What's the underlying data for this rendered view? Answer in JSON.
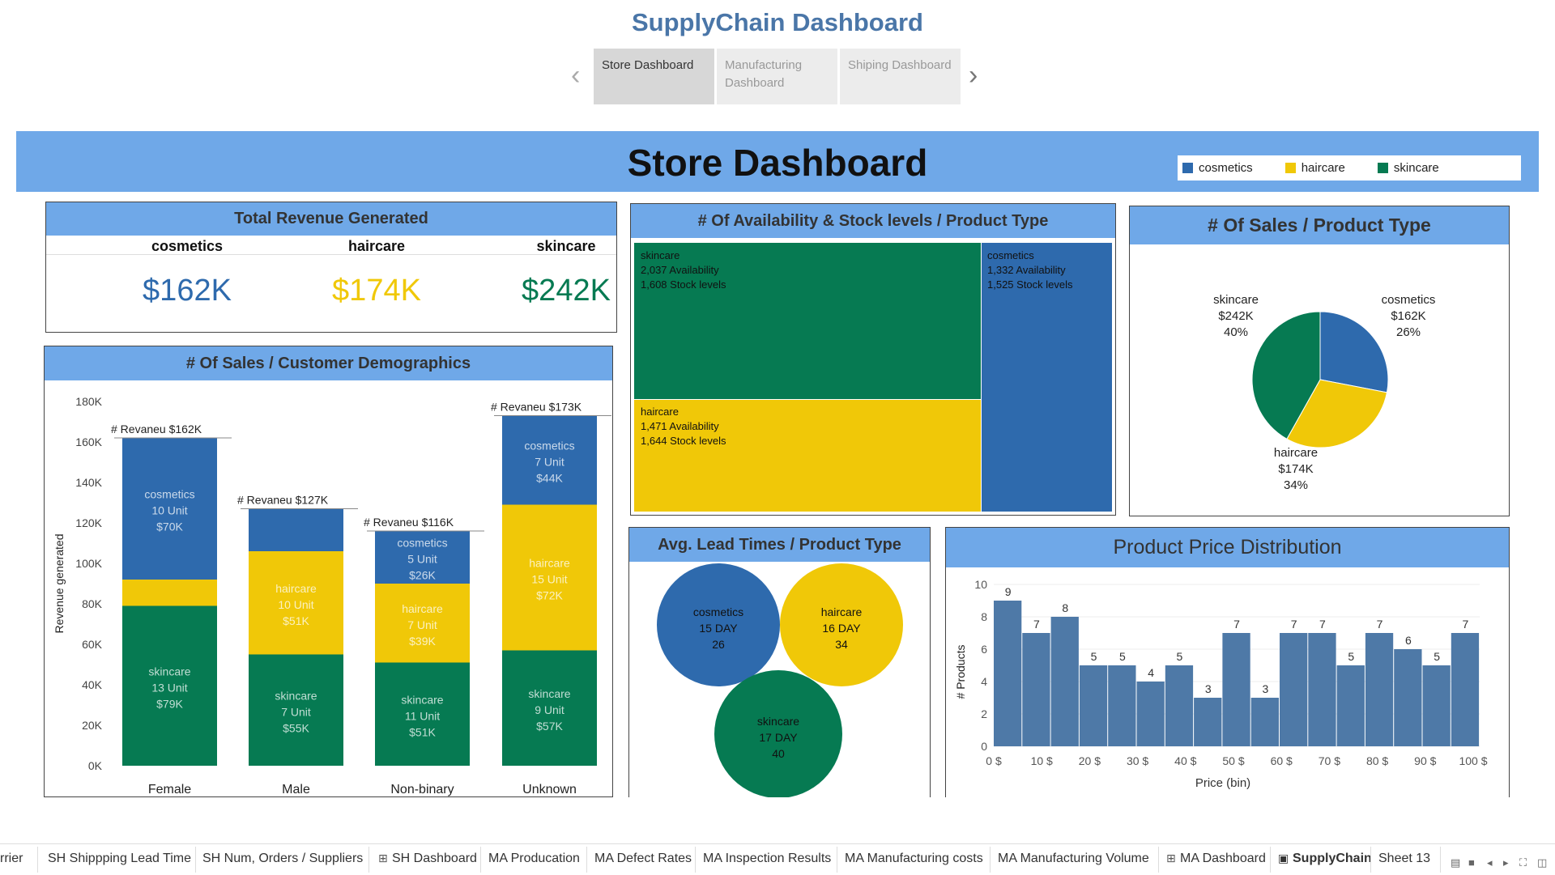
{
  "app_title": "SupplyChain Dashboard",
  "story_tabs": [
    {
      "label": "Store Dashboard"
    },
    {
      "label": "Manufacturing Dashboard"
    },
    {
      "label": "Shiping Dashboard"
    }
  ],
  "banner": {
    "title": "Store Dashboard"
  },
  "legend": [
    {
      "label": "cosmetics",
      "color": "#2e6aad"
    },
    {
      "label": "haircare",
      "color": "#f0c808"
    },
    {
      "label": "skincare",
      "color": "#067a52"
    }
  ],
  "revenue_panel": {
    "title": "Total Revenue Generated",
    "items": [
      {
        "category": "cosmetics",
        "value": "$162K",
        "color": "#2e6aad"
      },
      {
        "category": "haircare",
        "value": "$174K",
        "color": "#f0c808"
      },
      {
        "category": "skincare",
        "value": "$242K",
        "color": "#067a52"
      }
    ]
  },
  "availability_panel": {
    "title": "# Of Availability & Stock levels / Product Type",
    "cells": [
      {
        "name": "skincare",
        "availability": "2,037 Availability",
        "stock": "1,608 Stock levels",
        "color": "#067a52"
      },
      {
        "name": "cosmetics",
        "availability": "1,332 Availability",
        "stock": "1,525 Stock levels",
        "color": "#2e6aad"
      },
      {
        "name": "haircare",
        "availability": "1,471 Availability",
        "stock": "1,644 Stock levels",
        "color": "#f0c808"
      }
    ]
  },
  "sales_type_panel": {
    "title": "# Of Sales / Product Type"
  },
  "demographics_panel": {
    "title": "# Of Sales / Customer Demographics"
  },
  "lead_panel": {
    "title": "Avg. Lead Times / Product Type"
  },
  "price_panel": {
    "title": "Product Price Distribution"
  },
  "chart_data": [
    {
      "type": "bar",
      "title": "# Of Sales / Customer Demographics",
      "ylabel": "Revenue generated",
      "ylim": [
        0,
        180000
      ],
      "yticks": [
        "0K",
        "20K",
        "40K",
        "60K",
        "80K",
        "100K",
        "120K",
        "140K",
        "160K",
        "180K"
      ],
      "categories": [
        "Female",
        "Male",
        "Non-binary",
        "Unknown"
      ],
      "totals": [
        "# Revaneu $162K",
        "# Revaneu $127K",
        "# Revaneu $116K",
        "# Revaneu $173K"
      ],
      "series": [
        {
          "name": "skincare",
          "color": "#067a52",
          "values": [
            79000,
            55000,
            51000,
            57000
          ],
          "labels": [
            [
              "skincare",
              "13 Unit",
              "$79K"
            ],
            [
              "skincare",
              "7 Unit",
              "$55K"
            ],
            [
              "skincare",
              "11 Unit",
              "$51K"
            ],
            [
              "skincare",
              "9 Unit",
              "$57K"
            ]
          ]
        },
        {
          "name": "haircare",
          "color": "#f0c808",
          "values": [
            13000,
            51000,
            39000,
            72000
          ],
          "labels": [
            null,
            [
              "haircare",
              "10 Unit",
              "$51K"
            ],
            [
              "haircare",
              "7 Unit",
              "$39K"
            ],
            [
              "haircare",
              "15 Unit",
              "$72K"
            ]
          ]
        },
        {
          "name": "cosmetics",
          "color": "#2e6aad",
          "values": [
            70000,
            21000,
            26000,
            44000
          ],
          "labels": [
            [
              "cosmetics",
              "10 Unit",
              "$70K"
            ],
            null,
            [
              "cosmetics",
              "5 Unit",
              "$26K"
            ],
            [
              "cosmetics",
              "7 Unit",
              "$44K"
            ]
          ]
        }
      ]
    },
    {
      "type": "pie",
      "title": "# Of Sales / Product Type",
      "slices": [
        {
          "name": "cosmetics",
          "value": 162,
          "label": [
            "cosmetics",
            "$162K",
            "26%"
          ],
          "color": "#2e6aad"
        },
        {
          "name": "haircare",
          "value": 174,
          "label": [
            "haircare",
            "$174K",
            "34%"
          ],
          "color": "#f0c808"
        },
        {
          "name": "skincare",
          "value": 242,
          "label": [
            "skincare",
            "$242K",
            "40%"
          ],
          "color": "#067a52"
        }
      ]
    },
    {
      "type": "bubble",
      "title": "Avg. Lead Times / Product Type",
      "bubbles": [
        {
          "name": "cosmetics",
          "lines": [
            "cosmetics",
            "15 DAY",
            "26"
          ],
          "color": "#2e6aad"
        },
        {
          "name": "haircare",
          "lines": [
            "haircare",
            "16 DAY",
            "34"
          ],
          "color": "#f0c808"
        },
        {
          "name": "skincare",
          "lines": [
            "skincare",
            "17 DAY",
            "40"
          ],
          "color": "#067a52"
        }
      ]
    },
    {
      "type": "bar",
      "title": "Product Price Distribution",
      "xlabel": "Price (bin)",
      "ylabel": "# Products",
      "ylim": [
        0,
        10
      ],
      "yticks": [
        0,
        2,
        4,
        6,
        8,
        10
      ],
      "xticks": [
        "0 $",
        "10 $",
        "20 $",
        "30 $",
        "40 $",
        "50 $",
        "60 $",
        "70 $",
        "80 $",
        "90 $",
        "100 $"
      ],
      "values": [
        9,
        7,
        8,
        5,
        5,
        4,
        5,
        3,
        7,
        3,
        7,
        7,
        5,
        7,
        6,
        5,
        7
      ],
      "color": "#4e79a7"
    }
  ],
  "sheet_tabs": [
    {
      "label": "rrier"
    },
    {
      "label": "SH Shippping Lead Time"
    },
    {
      "label": "SH Num, Orders / Suppliers"
    },
    {
      "label": "SH Dashboard",
      "icon": "dashboard-grid-icon"
    },
    {
      "label": "MA Producation"
    },
    {
      "label": "MA Defect Rates"
    },
    {
      "label": "MA Inspection Results"
    },
    {
      "label": "MA Manufacturing costs"
    },
    {
      "label": "MA Manufacturing Volume"
    },
    {
      "label": "MA Dashboard",
      "icon": "dashboard-grid-icon"
    },
    {
      "label": "SupplyChain",
      "icon": "story-icon",
      "active": true
    },
    {
      "label": "Sheet 13"
    }
  ]
}
